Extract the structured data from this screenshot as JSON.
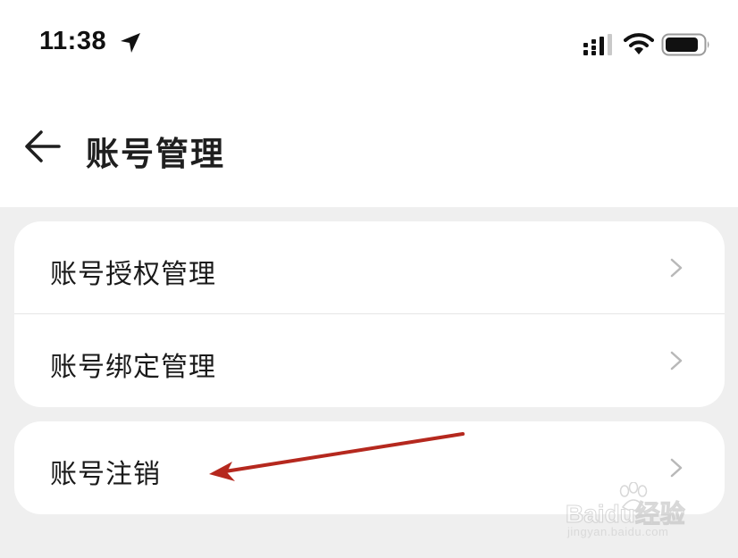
{
  "status_bar": {
    "time": "11:38"
  },
  "header": {
    "title": "账号管理"
  },
  "menu_group_1": [
    {
      "label": "账号授权管理"
    },
    {
      "label": "账号绑定管理"
    }
  ],
  "menu_group_2": [
    {
      "label": "账号注销"
    }
  ],
  "watermark": {
    "brand": "Baidu经验",
    "url": "jingyan.baidu.com"
  },
  "annotation": {
    "arrow_color": "#b5281e"
  }
}
